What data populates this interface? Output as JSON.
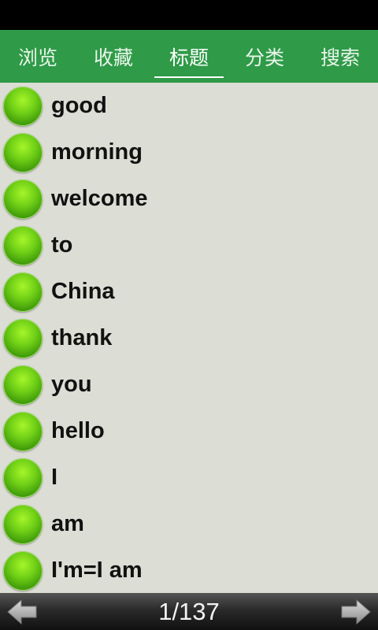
{
  "tabs": [
    {
      "label": "浏览"
    },
    {
      "label": "收藏"
    },
    {
      "label": "标题",
      "active": true
    },
    {
      "label": "分类"
    },
    {
      "label": "搜索"
    }
  ],
  "list": {
    "items": [
      {
        "label": "good"
      },
      {
        "label": "morning"
      },
      {
        "label": "welcome"
      },
      {
        "label": "to"
      },
      {
        "label": "China"
      },
      {
        "label": "thank"
      },
      {
        "label": "you"
      },
      {
        "label": "hello"
      },
      {
        "label": "I"
      },
      {
        "label": "am"
      },
      {
        "label": "I'm=I am"
      }
    ],
    "bullet_icon": "green-ball-icon"
  },
  "footer": {
    "page_indicator": "1/137",
    "prev_icon": "left-arrow-icon",
    "next_icon": "right-arrow-icon"
  },
  "colors": {
    "tab_bar": "#2f9a48",
    "list_background": "#dcddd5",
    "bullet": "#6fcf16"
  }
}
